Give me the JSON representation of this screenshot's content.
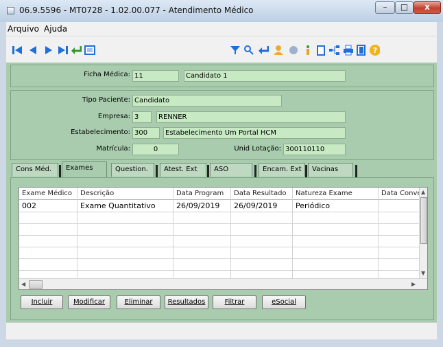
{
  "window": {
    "title": "06.9.5596 - MT0728 - 1.02.00.077 - Atendimento Médico",
    "minimize": "–",
    "maximize": "□",
    "close": "x"
  },
  "menu": {
    "items": [
      "Arquivo",
      "Ajuda"
    ]
  },
  "toolbar": {
    "nav": {
      "first": "first-record-icon",
      "prev": "previous-record-icon",
      "next": "next-record-icon",
      "last": "last-record-icon",
      "goto": "goto-icon",
      "zoom": "zoom-record-icon"
    },
    "actions": [
      "filter-icon",
      "search-icon",
      "return-icon",
      "user-icon",
      "circle-icon",
      "info-icon",
      "clipboard-icon",
      "tree-icon",
      "print-icon",
      "exit-icon",
      "help-icon"
    ]
  },
  "ficha": {
    "label": "Ficha Médica:",
    "number": "11",
    "name": "Candidato 1"
  },
  "paciente": {
    "tipo_label": "Tipo Paciente:",
    "tipo_value": "Candidato",
    "empresa_label": "Empresa:",
    "empresa_code": "3",
    "empresa_name": "RENNER",
    "estab_label": "Estabelecimento:",
    "estab_code": "300",
    "estab_name": "Estabelecimento Um Portal HCM",
    "matricula_label": "Matrícula:",
    "matricula_value": "0",
    "unid_label": "Unid Lotação:",
    "unid_value": "300110110"
  },
  "tabs": [
    "Cons Méd.",
    "Exames",
    "Question.",
    "Atest. Ext",
    "ASO",
    "Encam. Ext",
    "Vacinas"
  ],
  "active_tab": "Exames",
  "grid": {
    "columns": [
      "Exame Médico",
      "Descrição",
      "Data Program",
      "Data Resultado",
      "Natureza Exame",
      "Data Conve"
    ],
    "rows": [
      [
        "002",
        "Exame Quantitativo",
        "26/09/2019",
        "26/09/2019",
        "Periódico",
        ""
      ]
    ]
  },
  "buttons": [
    "Incluir",
    "Modificar",
    "Eliminar",
    "Resultados",
    "Filtrar",
    "eSocial"
  ],
  "colors": {
    "panel": "#a8ccad",
    "field": "#c7e9c4",
    "nav_icon": "#1e6fd9",
    "return_icon": "#2a9a2a"
  }
}
